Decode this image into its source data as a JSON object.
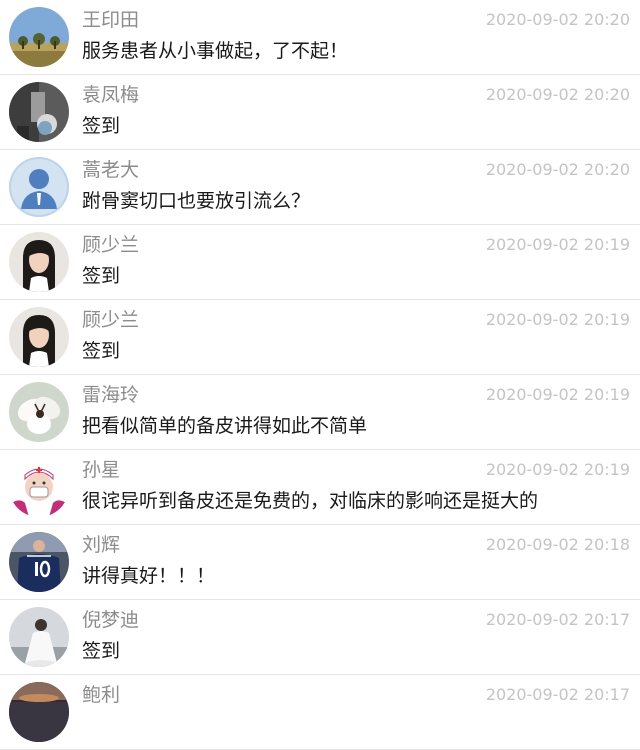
{
  "comments": [
    {
      "name": "王印田",
      "time": "2020-09-02 20:20",
      "text": "服务患者从小事做起，了不起！",
      "avatar": "landscape-photo"
    },
    {
      "name": "袁凤梅",
      "time": "2020-09-02 20:20",
      "text": "签到",
      "avatar": "monochrome-photo"
    },
    {
      "name": "蒿老大",
      "time": "2020-09-02 20:20",
      "text": "跗骨窦切口也要放引流么？",
      "avatar": "default-person"
    },
    {
      "name": "顾少兰",
      "time": "2020-09-02 20:19",
      "text": "签到",
      "avatar": "portrait-woman"
    },
    {
      "name": "顾少兰",
      "time": "2020-09-02 20:19",
      "text": "签到",
      "avatar": "portrait-woman"
    },
    {
      "name": "雷海玲",
      "time": "2020-09-02 20:19",
      "text": "把看似简单的备皮讲得如此不简单",
      "avatar": "flower"
    },
    {
      "name": "孙星",
      "time": "2020-09-02 20:19",
      "text": "很诧异听到备皮还是免费的，对临床的影响还是挺大的",
      "avatar": "nurse-cartoon"
    },
    {
      "name": "刘辉",
      "time": "2020-09-02 20:18",
      "text": "讲得真好！！！",
      "avatar": "jersey-10"
    },
    {
      "name": "倪梦迪",
      "time": "2020-09-02 20:17",
      "text": "签到",
      "avatar": "dress-photo"
    },
    {
      "name": "鲍利",
      "time": "2020-09-02 20:17",
      "text": "",
      "avatar": "sunset-photo"
    }
  ],
  "colors": {
    "name": "#8c8c8c",
    "time": "#c4c4c4",
    "text": "#1a1a1a",
    "divider": "#e6e6e6"
  }
}
